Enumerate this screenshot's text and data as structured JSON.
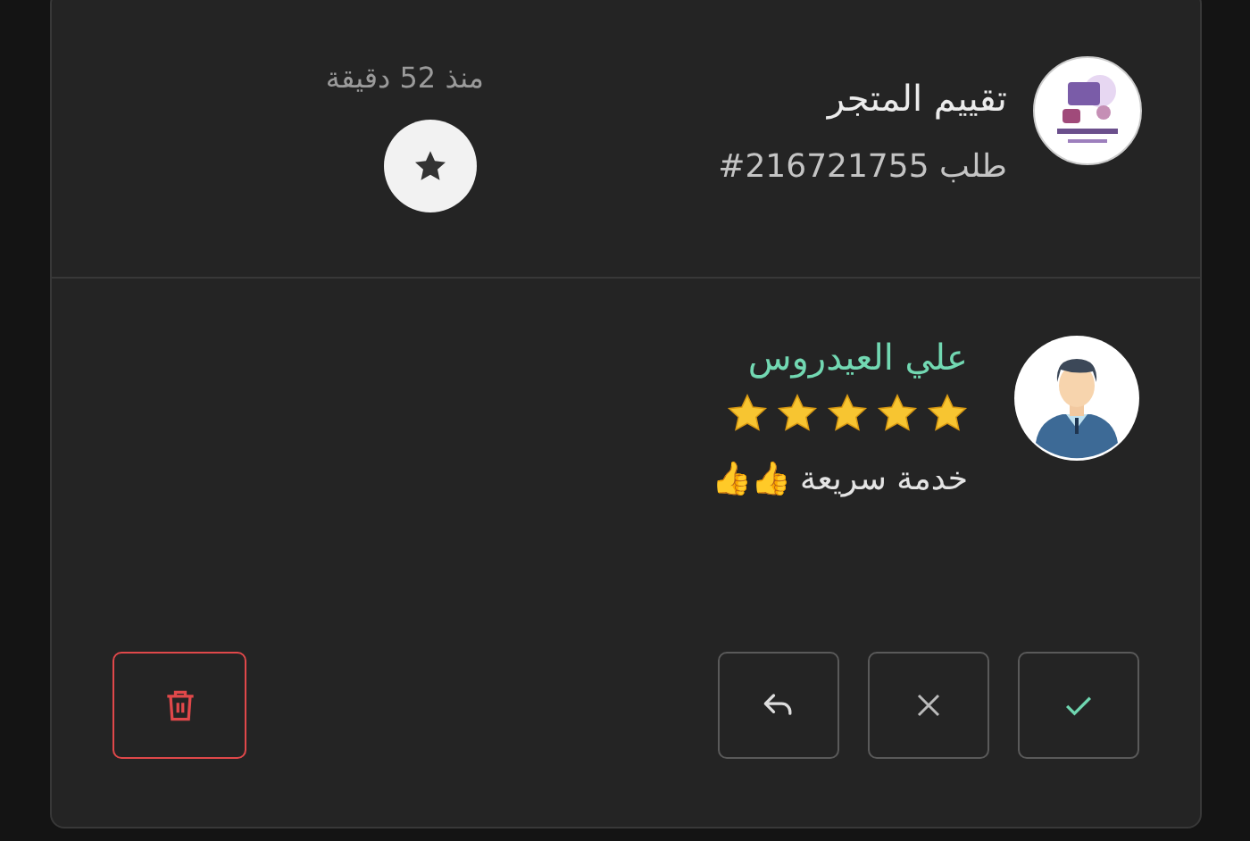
{
  "header": {
    "title": "تقييم المتجر",
    "order_label": "طلب",
    "order_number": "#216721755",
    "time": "منذ 52 دقيقة"
  },
  "review": {
    "author": "علي العيدروس",
    "stars": 5,
    "comment": "خدمة سريعة 👍👍"
  },
  "actions": [
    {
      "kind": "approve"
    },
    {
      "kind": "reject"
    },
    {
      "kind": "reply"
    },
    {
      "kind": "delete"
    }
  ]
}
